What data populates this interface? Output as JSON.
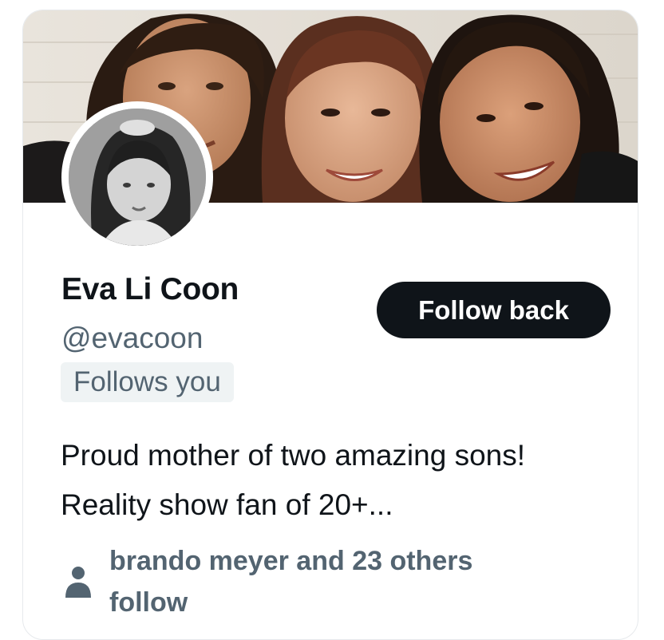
{
  "profile": {
    "name": "Eva Li Coon",
    "handle": "@evacoon",
    "follows_badge": "Follows you",
    "follow_button": "Follow back",
    "bio": "Proud mother of two amazing sons! Reality show fan of 20+...",
    "mutuals": "brando meyer and 23 others follow"
  },
  "icons": {
    "mutuals_icon": "person-icon"
  },
  "colors": {
    "primary_text": "#0f1419",
    "secondary_text": "#536471",
    "button_bg": "#0f1419",
    "button_text": "#ffffff",
    "badge_bg": "#eff3f4",
    "card_border": "#e6e9ec"
  }
}
